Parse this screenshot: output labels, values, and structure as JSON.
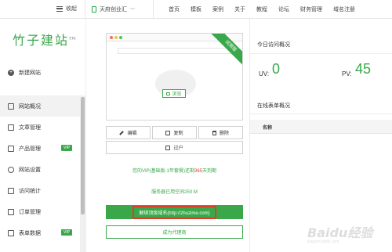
{
  "topbar": {
    "collapse_label": "收起",
    "site_name": "天府创业汇",
    "nav": [
      "首页",
      "模板",
      "案例",
      "关于",
      "教程",
      "论坛",
      "财务管理",
      "域名注册"
    ]
  },
  "sidebar": {
    "logo": "竹子建站",
    "logo_tm": "TM",
    "new_site": "新建网站",
    "items": [
      {
        "label": "网站概况",
        "icon": "monitor-icon",
        "active": true
      },
      {
        "label": "文章管理",
        "icon": "document-icon"
      },
      {
        "label": "产品管理",
        "icon": "box-icon",
        "badge": "VIP"
      },
      {
        "label": "网站设置",
        "icon": "gear-icon"
      },
      {
        "label": "访问统计",
        "icon": "chart-icon"
      },
      {
        "label": "订单管理",
        "icon": "order-icon"
      },
      {
        "label": "表单数据",
        "icon": "form-icon",
        "badge": "VIP"
      }
    ]
  },
  "site_card": {
    "ribbon": "试用版",
    "browse_label": "浏览"
  },
  "actions": {
    "edit": "编辑",
    "copy": "复制",
    "delete": "删除",
    "transfer": "过户"
  },
  "vip_info": {
    "prefix": "您的VIP(基础版-1年套餐)还剩",
    "days": "365",
    "suffix": "天到期"
  },
  "space_info": "服务器已用空间250 M",
  "bind_domain_button": "解绑顶级域名(http://zhuzime.com)",
  "agent_button": "成为代理商",
  "today_visits": {
    "title": "今日访问概况",
    "uv_label": "UV:",
    "uv_value": "0",
    "pv_label": "PV:",
    "pv_value": "45"
  },
  "online_forms": {
    "title": "在线表单概况",
    "column": "名称"
  },
  "watermark": {
    "main": "Baidu经验",
    "sub": "jingyan.baidu.com"
  },
  "colors": {
    "accent": "#3aa84a",
    "highlight": "#d94025",
    "red": "#e53935"
  }
}
